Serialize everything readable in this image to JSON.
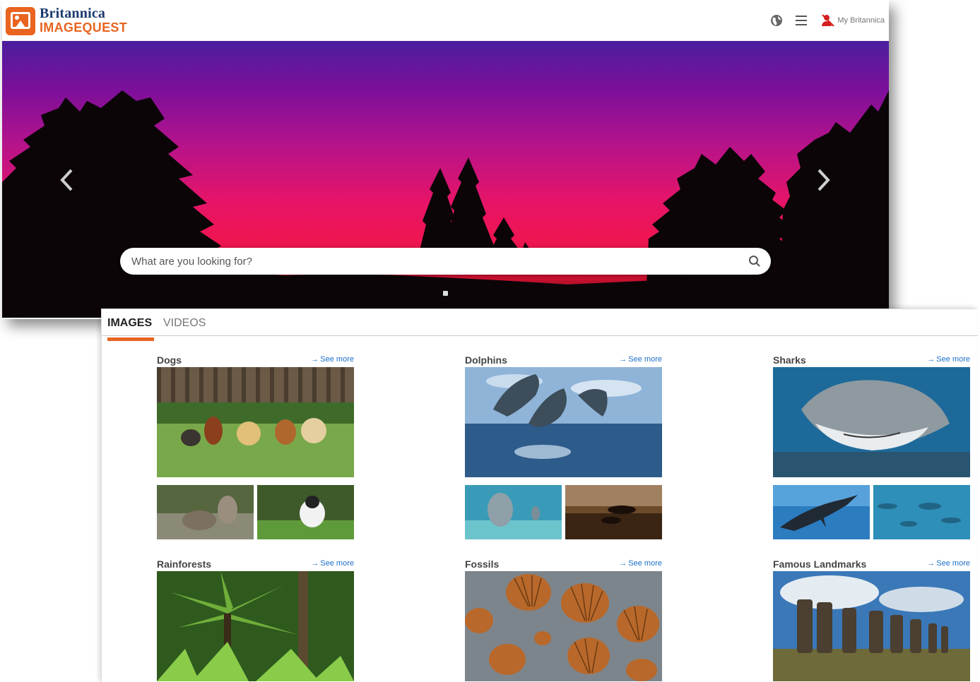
{
  "brand": {
    "name": "Britannica",
    "product": "IMAGEQUEST",
    "logo_color": "#e8641f",
    "title_color": "#1a3a6e"
  },
  "header": {
    "icons": [
      "globe-icon",
      "menu-icon",
      "user-icon"
    ],
    "account_label": "My Britannica"
  },
  "hero": {
    "search_placeholder": "What are you looking for?",
    "colors": {
      "top": "#4b1e9e",
      "middle": "#e61468",
      "bottom": "#1b0a0f"
    }
  },
  "tabs": [
    {
      "label": "IMAGES",
      "active": true
    },
    {
      "label": "VIDEOS",
      "active": false
    }
  ],
  "accent_color": "#e8641f",
  "link_color": "#1a6fc9",
  "categories": [
    {
      "title": "Dogs",
      "see_more": "See more",
      "images": [
        "dogs-main-image",
        "wolf-pups-thumbnail",
        "running-dog-thumbnail"
      ]
    },
    {
      "title": "Dolphins",
      "see_more": "See more",
      "images": [
        "dolphins-main-image",
        "underwater-dolphin-thumbnail",
        "sunset-dolphins-thumbnail"
      ]
    },
    {
      "title": "Sharks",
      "see_more": "See more",
      "images": [
        "shark-main-image",
        "shark-silhouette-thumbnail",
        "hammerhead-thumbnail"
      ]
    },
    {
      "title": "Rainforests",
      "see_more": "See more",
      "images": [
        "rainforest-main-image"
      ]
    },
    {
      "title": "Fossils",
      "see_more": "See more",
      "images": [
        "fossils-main-image"
      ]
    },
    {
      "title": "Famous Landmarks",
      "see_more": "See more",
      "images": [
        "moai-main-image"
      ]
    }
  ]
}
